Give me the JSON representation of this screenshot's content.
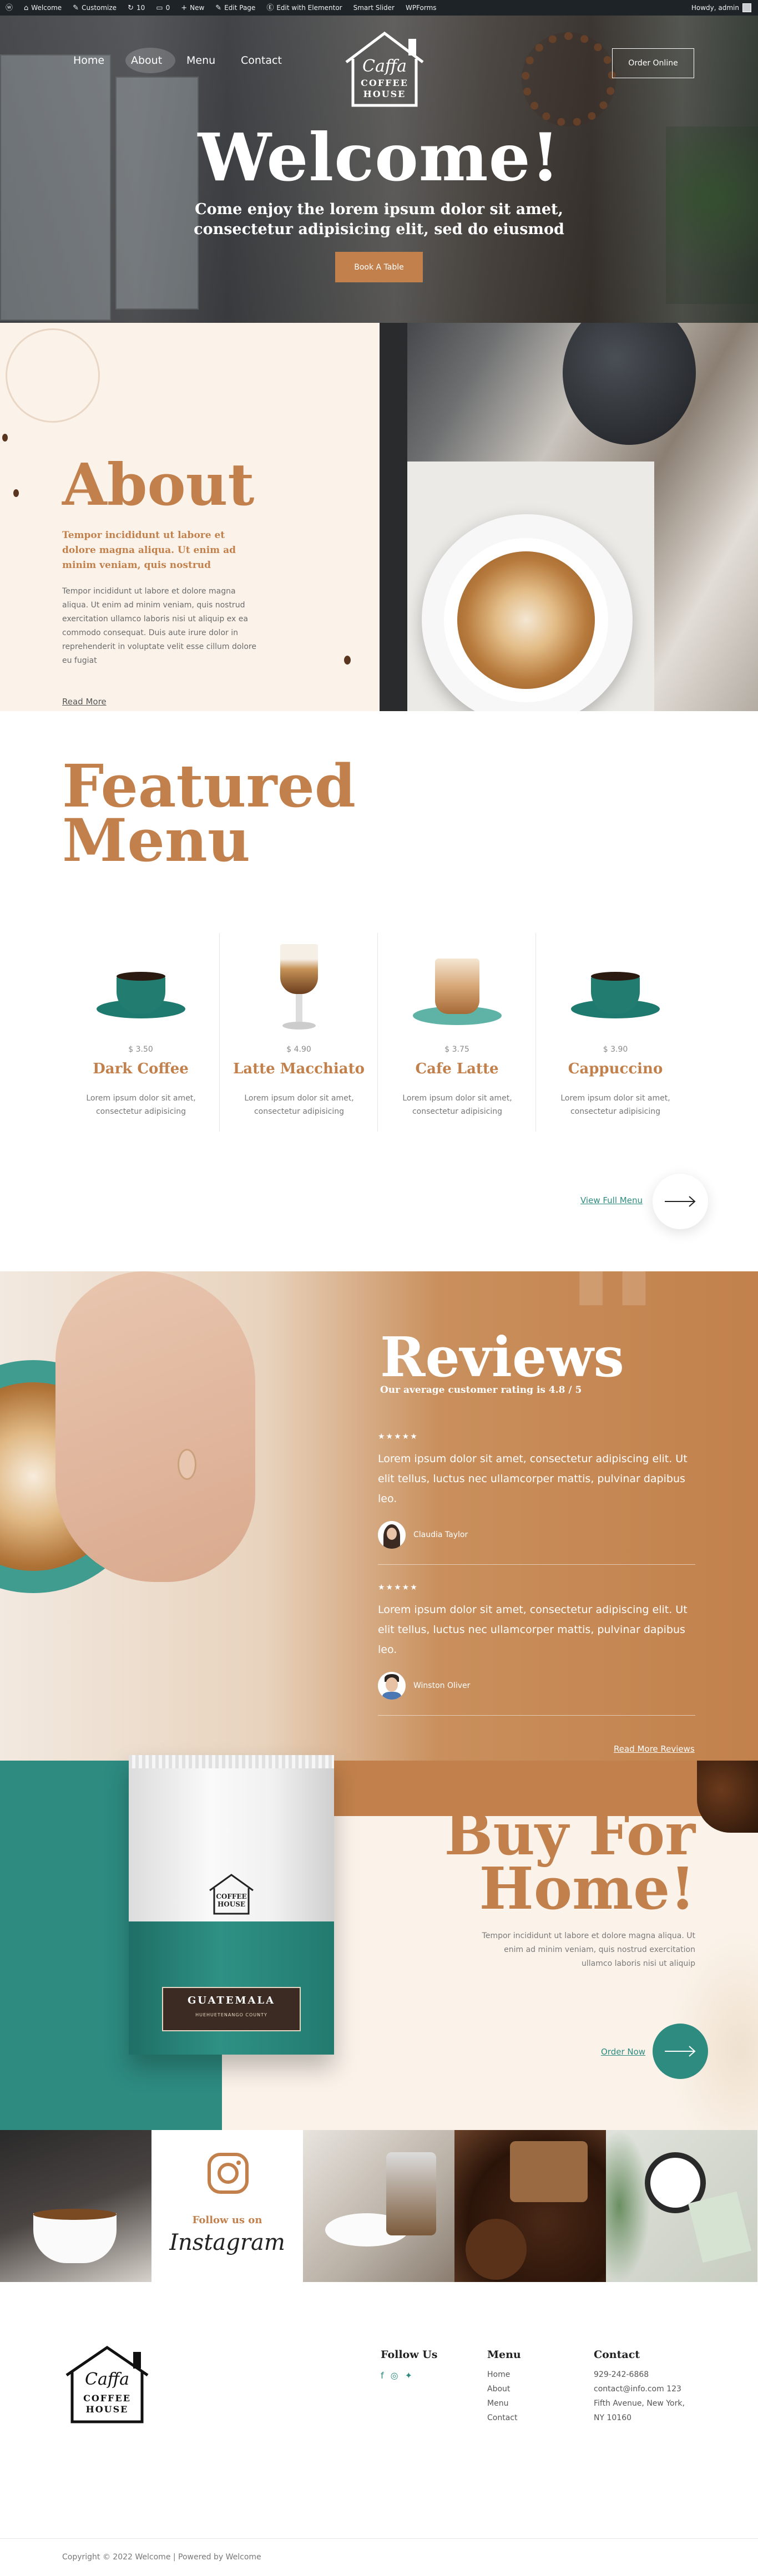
{
  "admin_bar": {
    "items": [
      "Welcome",
      "Customize",
      "10",
      "0",
      "New",
      "Edit Page",
      "Edit with Elementor",
      "Smart Slider",
      "WPForms"
    ],
    "greeting": "Howdy, admin"
  },
  "nav": {
    "links": [
      "Home",
      "About",
      "Menu",
      "Contact"
    ],
    "logo_script": "Caffa",
    "logo_line1": "COFFEE",
    "logo_line2": "HOUSE",
    "cta": "Order Online"
  },
  "hero": {
    "title": "Welcome!",
    "subtitle": "Come enjoy the lorem ipsum dolor sit amet, consectetur adipisicing elit, sed do eiusmod",
    "button": "Book A Table"
  },
  "about": {
    "title": "About",
    "lead": "Tempor incididunt ut labore et dolore magna aliqua. Ut enim ad minim veniam, quis nostrud",
    "body": "Tempor incididunt ut labore et dolore magna aliqua. Ut enim ad minim veniam, quis nostrud exercitation ullamco laboris nisi ut aliquip ex ea commodo consequat. Duis aute irure dolor in reprehenderit in voluptate velit esse cillum dolore eu fugiat",
    "link": "Read More"
  },
  "featured": {
    "title_line1": "Featured",
    "title_line2": "Menu",
    "items": [
      {
        "price": "$ 3.50",
        "name": "Dark Coffee",
        "desc": "Lorem ipsum dolor sit amet, consectetur adipisicing"
      },
      {
        "price": "$ 4.90",
        "name": "Latte Macchiato",
        "desc": "Lorem ipsum dolor sit amet, consectetur adipisicing"
      },
      {
        "price": "$ 3.75",
        "name": "Cafe Latte",
        "desc": "Lorem ipsum dolor sit amet, consectetur adipisicing"
      },
      {
        "price": "$ 3.90",
        "name": "Cappuccino",
        "desc": "Lorem ipsum dolor sit amet, consectetur adipisicing"
      }
    ],
    "view_full": "View Full Menu"
  },
  "reviews": {
    "title": "Reviews",
    "rating": "Our average customer rating is 4.8 / 5",
    "items": [
      {
        "stars": "★★★★★",
        "text": "Lorem ipsum dolor sit amet, consectetur adipiscing elit. Ut elit tellus, luctus nec ullamcorper mattis, pulvinar dapibus leo.",
        "name": "Claudia Taylor"
      },
      {
        "stars": "★★★★★",
        "text": "Lorem ipsum dolor sit amet, consectetur adipiscing elit. Ut elit tellus, luctus nec ullamcorper mattis, pulvinar dapibus leo.",
        "name": "Winston Oliver"
      }
    ],
    "read_more": "Read More Reviews"
  },
  "buy": {
    "title_line1": "Buy For",
    "title_line2": "Home!",
    "desc": "Tempor incididunt ut labore et dolore magna aliqua. Ut enim ad minim veniam, quis nostrud exercitation ullamco laboris nisi ut aliquip",
    "link": "Order Now",
    "bag_label": "GUATEMALA",
    "bag_sub": "HUEHUETENANGO COUNTY"
  },
  "instagram": {
    "follow": "Follow us on",
    "name": "Instagram"
  },
  "footer": {
    "follow_title": "Follow Us",
    "menu_title": "Menu",
    "menu_items": [
      "Home",
      "About",
      "Menu",
      "Contact"
    ],
    "contact_title": "Contact",
    "contact_lines": [
      "929-242-6868",
      "contact@info.com 123",
      "Fifth Avenue, New York,",
      "NY 10160"
    ],
    "copyright": "Copyright © 2022 Welcome | Powered by Welcome"
  },
  "colors": {
    "accent": "#c2814c",
    "teal": "#2d8b80",
    "cream": "#fbf3ea"
  }
}
